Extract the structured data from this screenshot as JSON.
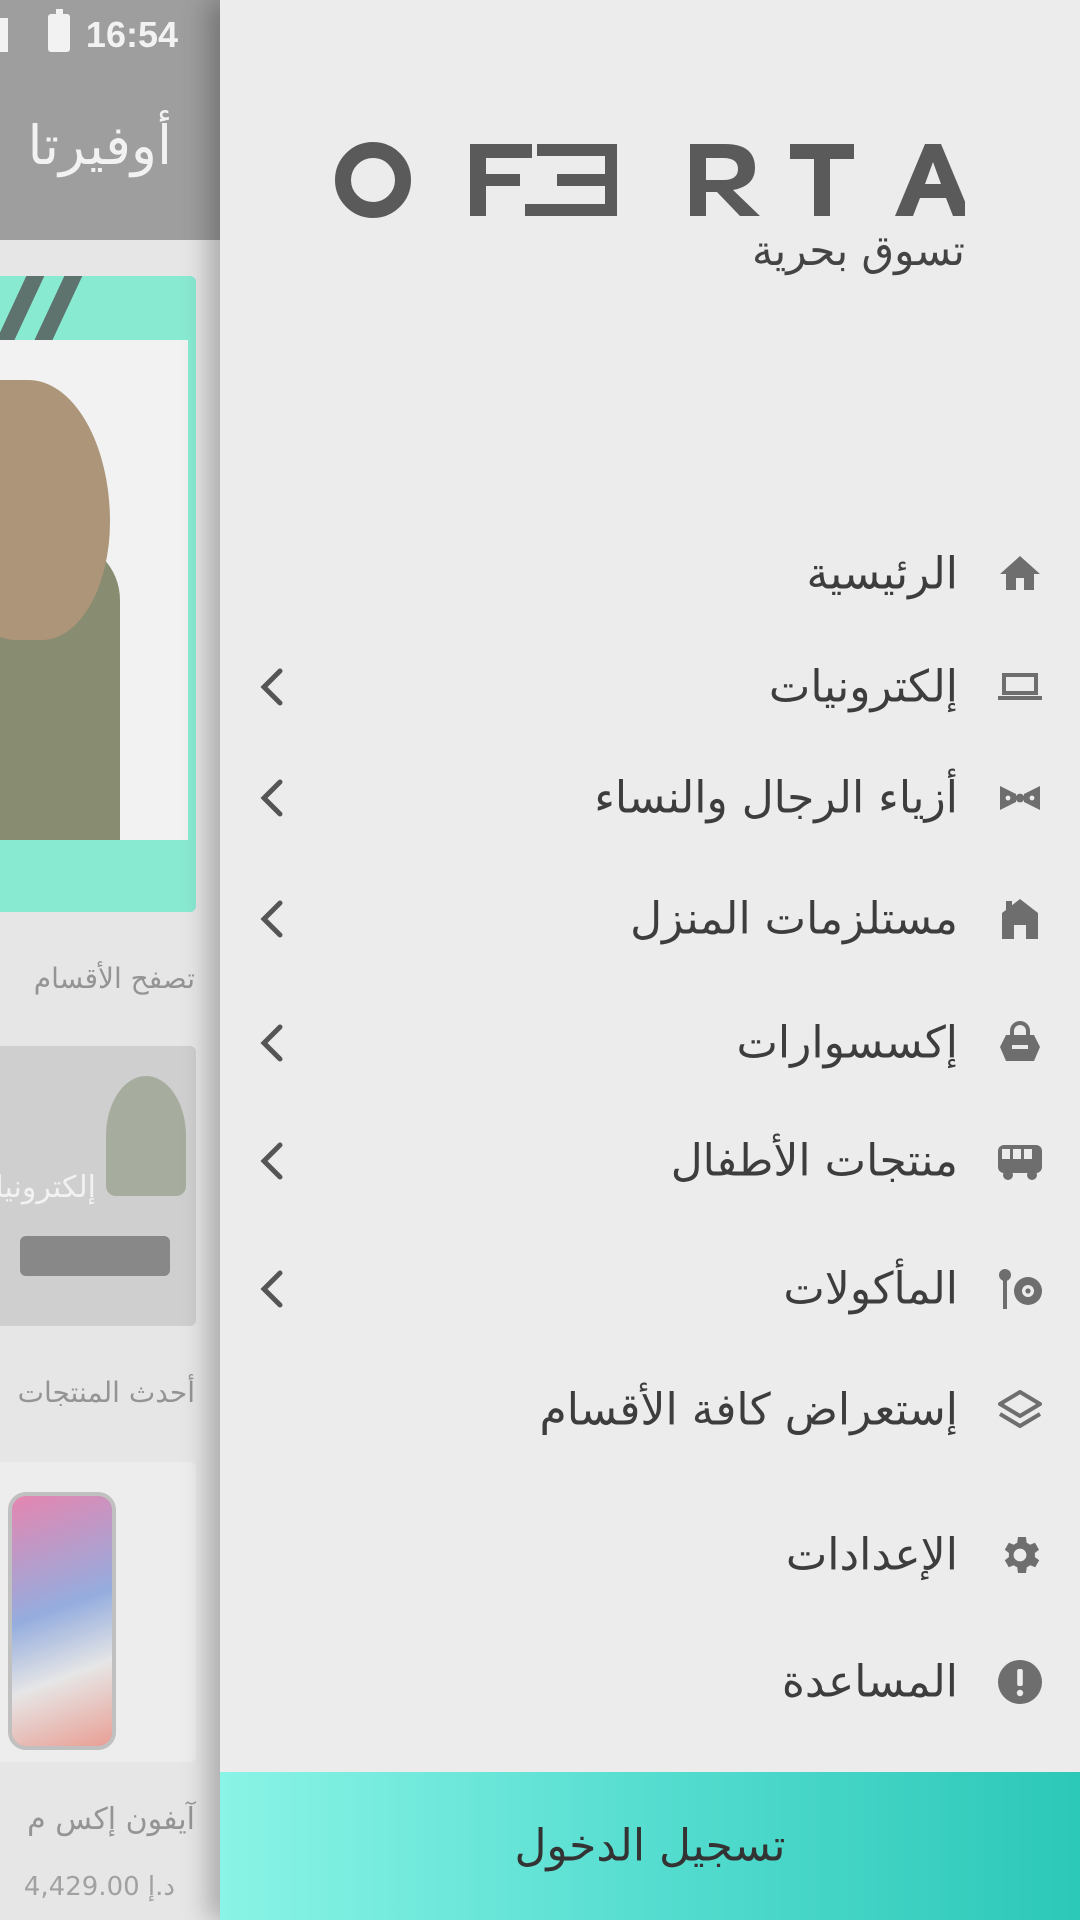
{
  "status_bar": {
    "time": "16:54"
  },
  "background_app": {
    "title": "أوفيرتا",
    "browse_label": "تصفح الأقسام",
    "category_card_label": "إلكترونيات",
    "latest_label": "أحدث المنتجات",
    "product": {
      "title": "آيفون إكس م",
      "price": "4,429.00 د.إ"
    }
  },
  "drawer": {
    "brand": {
      "logo_text": "OFERTA",
      "tagline": "تسوق بحرية"
    },
    "menu": [
      {
        "label": "الرئيسية",
        "icon": "home-icon",
        "has_submenu": false
      },
      {
        "label": "إلكترونيات",
        "icon": "laptop-icon",
        "has_submenu": true
      },
      {
        "label": "أزياء الرجال والنساء",
        "icon": "bow-tie-icon",
        "has_submenu": true
      },
      {
        "label": "مستلزمات المنزل",
        "icon": "house-icon",
        "has_submenu": true
      },
      {
        "label": "إكسسوارات",
        "icon": "bag-icon",
        "has_submenu": true
      },
      {
        "label": "منتجات الأطفال",
        "icon": "bus-icon",
        "has_submenu": true
      },
      {
        "label": "المأكولات",
        "icon": "dining-icon",
        "has_submenu": true
      },
      {
        "label": "إستعراض كافة الأقسام",
        "icon": "layers-icon",
        "has_submenu": false
      },
      {
        "label": "الإعدادات",
        "icon": "gear-icon",
        "has_submenu": false
      },
      {
        "label": "المساعدة",
        "icon": "help-icon",
        "has_submenu": false
      }
    ],
    "login_label": "تسجيل الدخول"
  },
  "colors": {
    "accent": "#2cc8b8",
    "accent_light": "#8af4e6",
    "drawer_bg": "#ececec",
    "icon_gray": "#6e6e6e",
    "text_dark": "#3d3d3d"
  }
}
